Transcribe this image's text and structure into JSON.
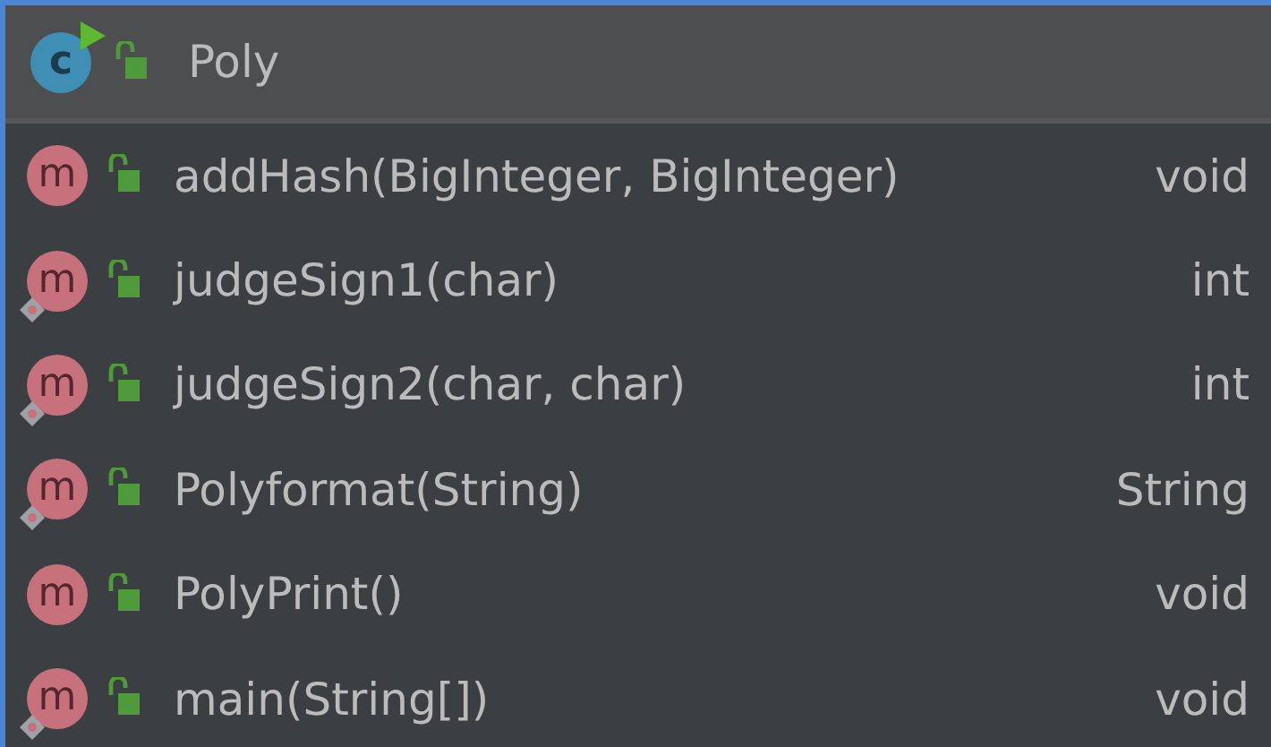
{
  "header": {
    "icon_letter": "c",
    "title": "Poly"
  },
  "members": [
    {
      "icon_letter": "m",
      "static": false,
      "signature": "addHash(BigInteger, BigInteger)",
      "type": "void"
    },
    {
      "icon_letter": "m",
      "static": true,
      "signature": "judgeSign1(char)",
      "type": "int"
    },
    {
      "icon_letter": "m",
      "static": true,
      "signature": "judgeSign2(char, char)",
      "type": "int"
    },
    {
      "icon_letter": "m",
      "static": true,
      "signature": "Polyformat(String)",
      "type": "String"
    },
    {
      "icon_letter": "m",
      "static": false,
      "signature": "PolyPrint()",
      "type": "void"
    },
    {
      "icon_letter": "m",
      "static": true,
      "signature": "main(String[])",
      "type": "void"
    }
  ]
}
